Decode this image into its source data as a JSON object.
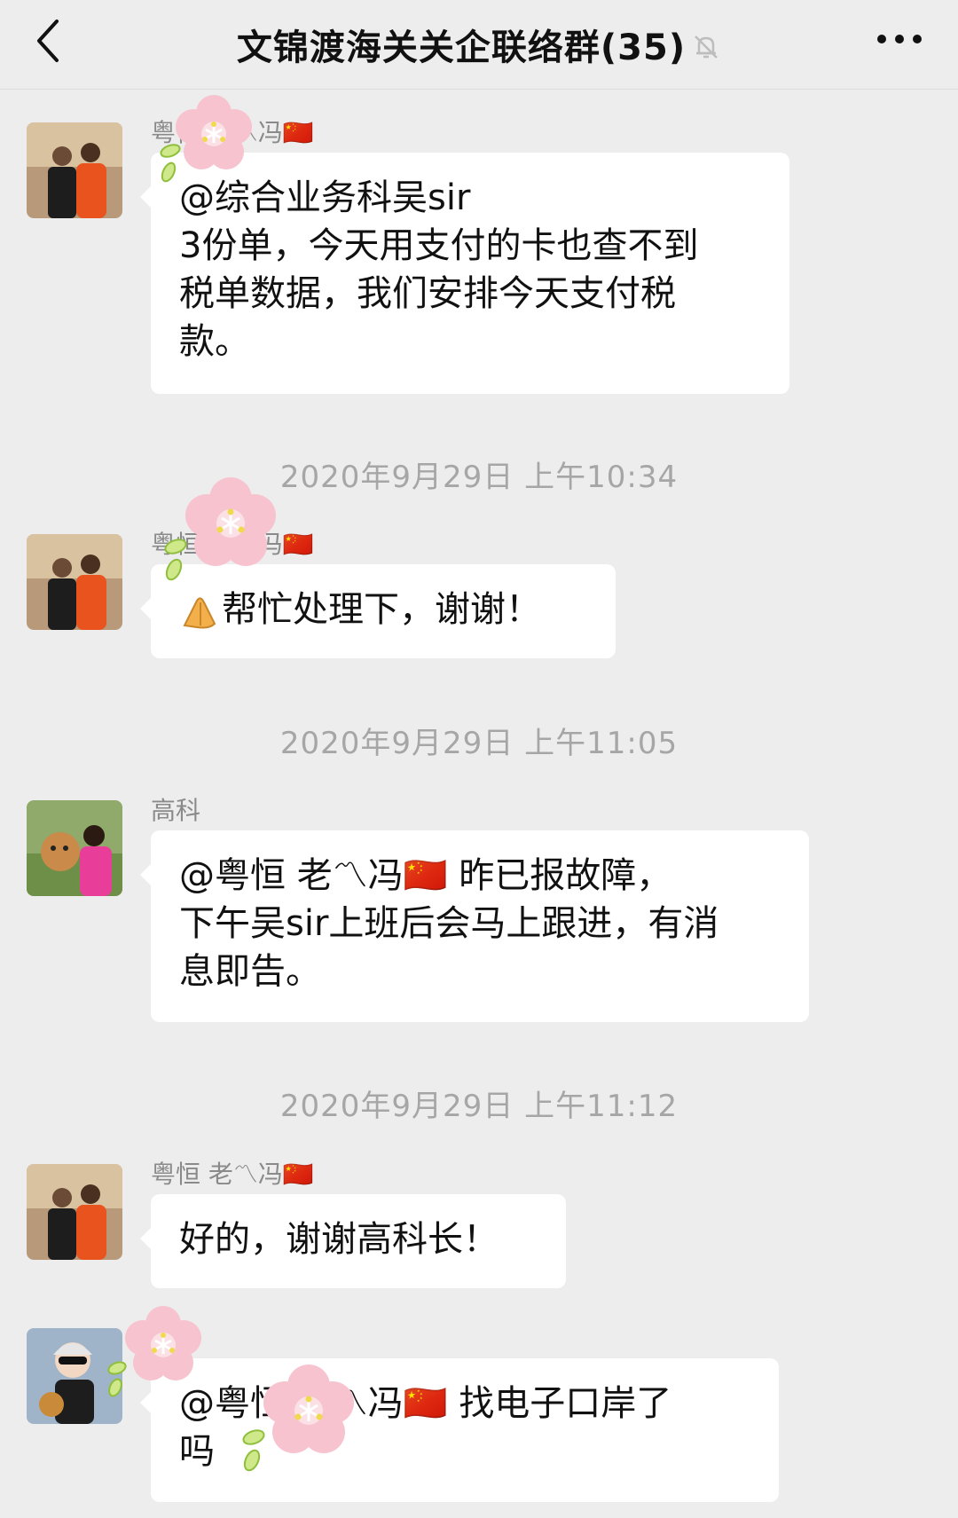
{
  "header": {
    "title": "文锦渡海关关企联络群(35)",
    "back_icon": "back-chevron-icon",
    "mute_icon": "muted-bell-icon",
    "more_icon": "more-dots-icon"
  },
  "messages": [
    {
      "sender": "粤恒 老〽冯🇨🇳",
      "lines": [
        "@综合业务科吴sir",
        "3份单，今天用支付的卡也查不到",
        "税单数据，我们安排今天支付税",
        "款。"
      ]
    },
    {
      "timestamp": "2020年9月29日 上午10:34",
      "sender": "粤恒 老〽冯🇨🇳",
      "lines": [
        "帮忙处理下，谢谢！"
      ]
    },
    {
      "timestamp": "2020年9月29日 上午11:05",
      "sender": "高科",
      "lines": [
        "@粤恒 老〽冯🇨🇳 昨已报故障，",
        "下午吴sir上班后会马上跟进，有消",
        "息即告。"
      ]
    },
    {
      "timestamp": "2020年9月29日 上午11:12",
      "sender": "粤恒 老〽冯🇨🇳",
      "lines": [
        "好的，谢谢高科长！"
      ]
    },
    {
      "sender": "",
      "lines": [
        "@粤恒 老〽冯🇨🇳 找电子口岸了",
        "吗"
      ]
    }
  ],
  "colors": {
    "background": "#ededed",
    "bubble": "#ffffff",
    "timestamp": "#a6a6a6",
    "sender": "#8a8a8a",
    "flower_petal": "#f6c3cf"
  }
}
